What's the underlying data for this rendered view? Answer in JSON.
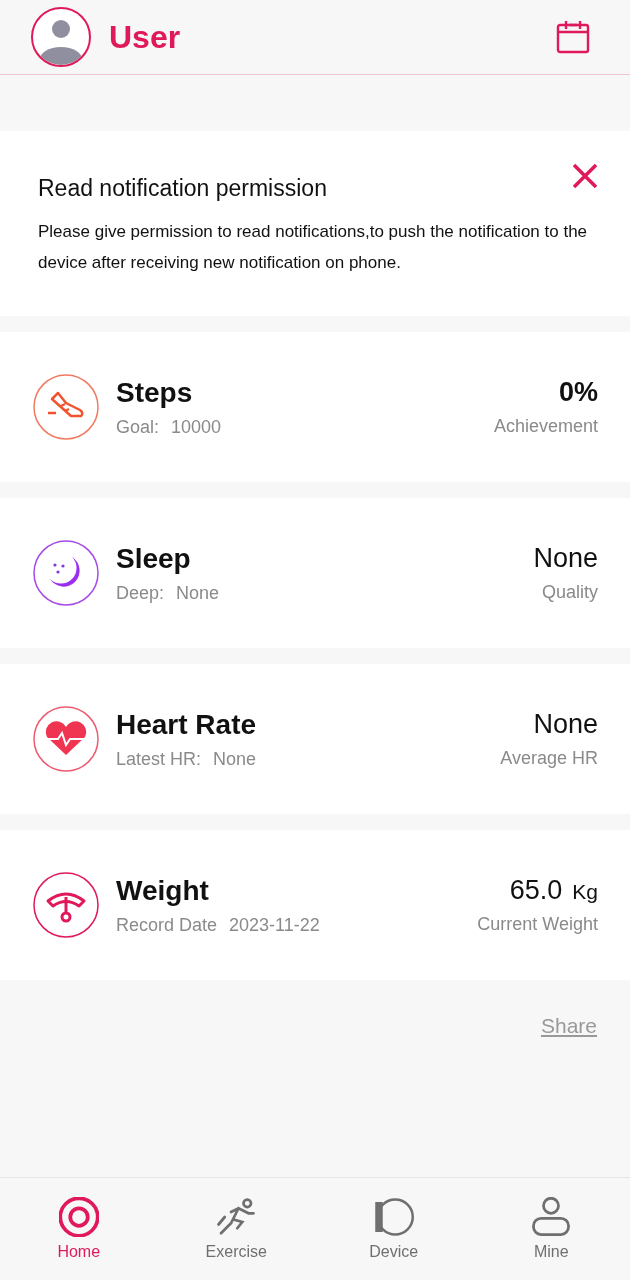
{
  "header": {
    "title": "User"
  },
  "notification": {
    "title": "Read notification permission",
    "body": "Please give permission to read notifications,to push the notification to the device after receiving new notification on phone."
  },
  "metrics": [
    {
      "kind": "steps",
      "title": "Steps",
      "sub_label": "Goal:",
      "sub_value": "10000",
      "value": "0%",
      "value_label": "Achievement"
    },
    {
      "kind": "sleep",
      "title": "Sleep",
      "sub_label": "Deep:",
      "sub_value": "None",
      "value": "None",
      "value_label": "Quality"
    },
    {
      "kind": "heart",
      "title": "Heart Rate",
      "sub_label": "Latest HR:",
      "sub_value": "None",
      "value": "None",
      "value_label": "Average HR"
    },
    {
      "kind": "weight",
      "title": "Weight",
      "sub_label": "Record Date",
      "sub_value": "2023-11-22",
      "value": "65.0",
      "unit": "Kg",
      "value_label": "Current Weight"
    }
  ],
  "share": "Share",
  "nav": [
    {
      "kind": "home",
      "label": "Home",
      "selected": true
    },
    {
      "kind": "exercise",
      "label": "Exercise",
      "selected": false
    },
    {
      "kind": "device",
      "label": "Device",
      "selected": false
    },
    {
      "kind": "mine",
      "label": "Mine",
      "selected": false
    }
  ]
}
